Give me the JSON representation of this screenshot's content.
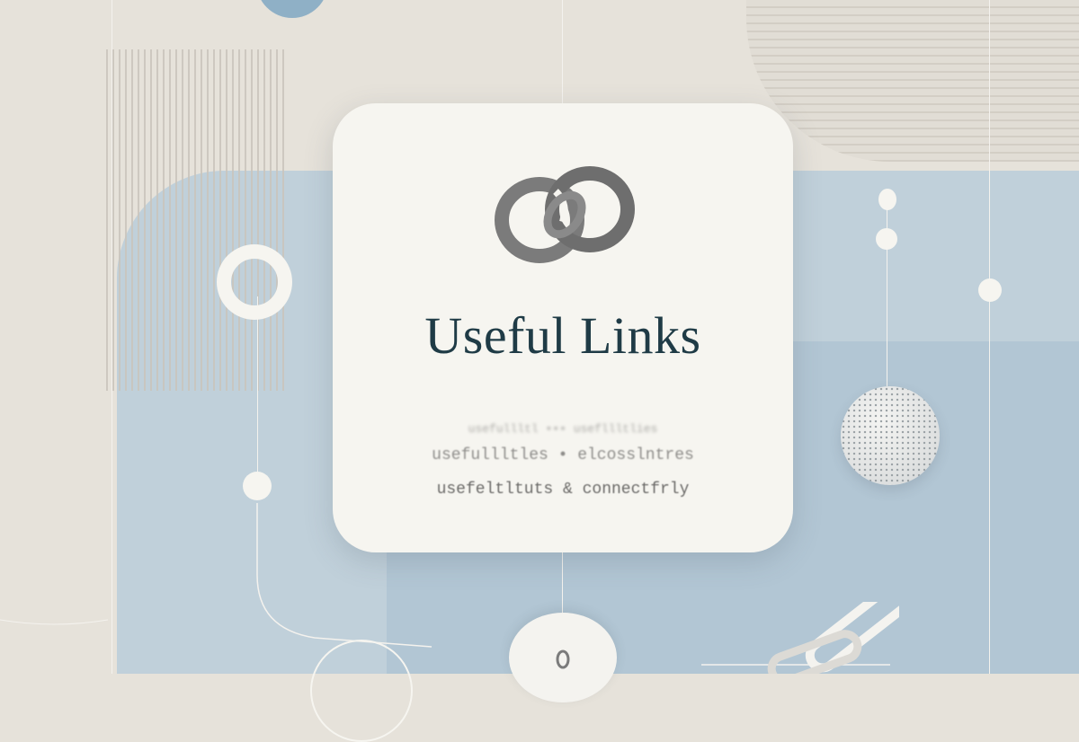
{
  "card": {
    "title": "Useful Links",
    "tagline_lines": [
      "usefullltl ••• usefllltlies",
      "usefullltles • elcosslntres",
      "usefeltltuts & connectfrly"
    ]
  },
  "icons": {
    "card_icon": "chain-link-icon",
    "bottom_icon": "chain-link-icon"
  },
  "colors": {
    "background": "#e6e2da",
    "blue_shape": "#b9ccd9",
    "card": "#f6f5f0",
    "title_text": "#1f3b46",
    "icon_gray": "#7b7b7b"
  }
}
